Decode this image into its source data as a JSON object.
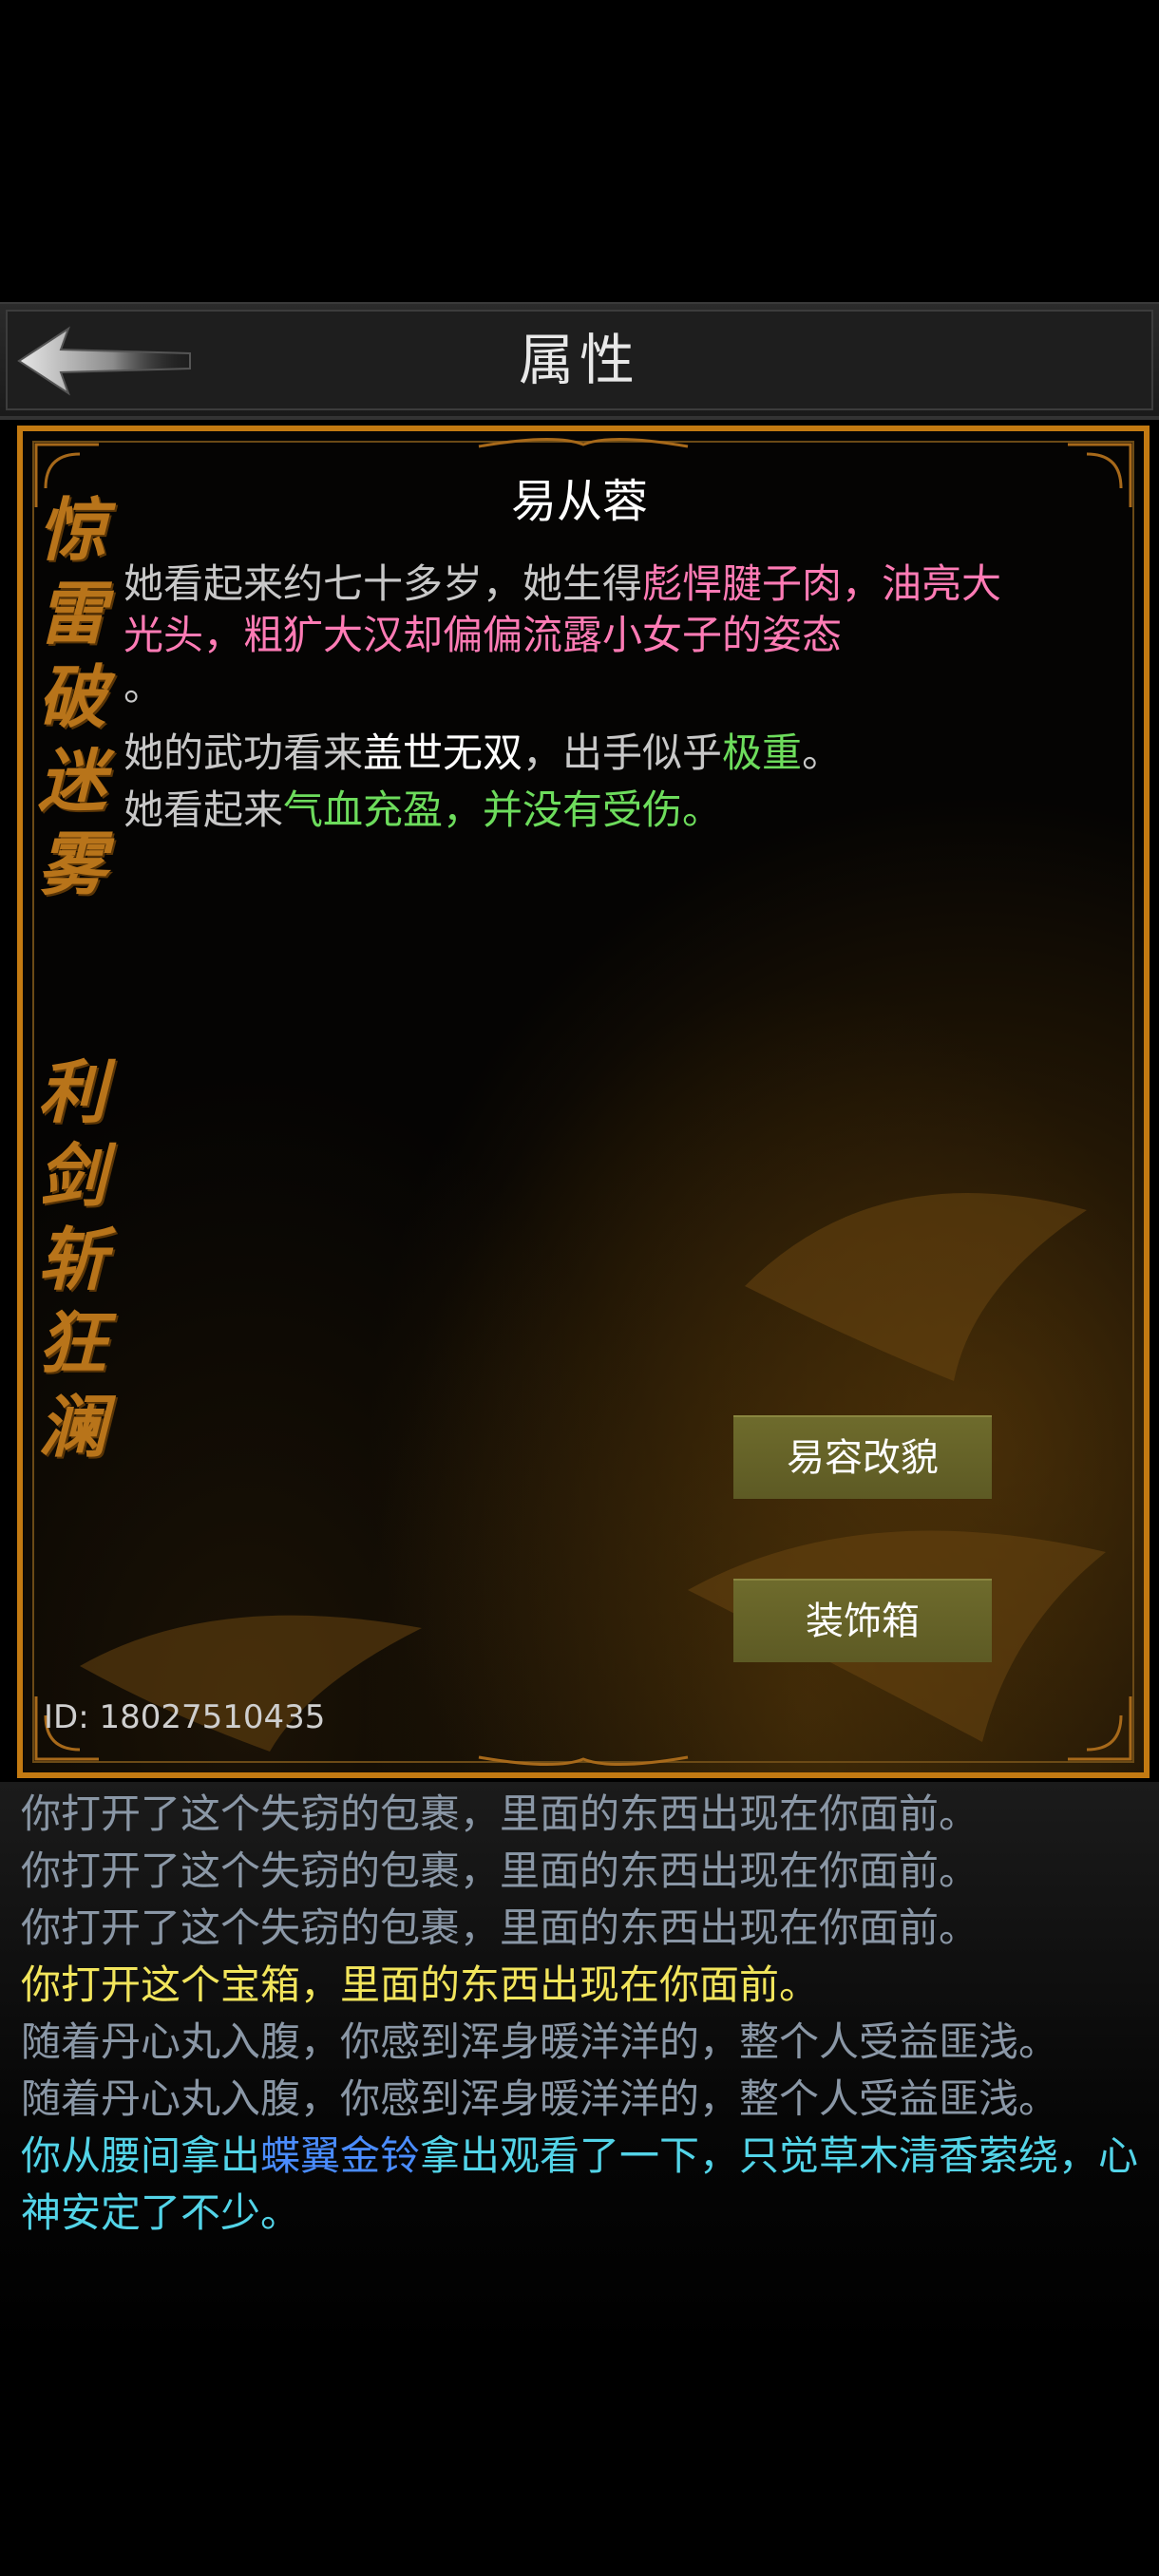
{
  "header": {
    "title": "属性",
    "back_icon": "back-arrow-icon"
  },
  "side_text": {
    "line1": "惊雷破迷雾",
    "line2": "利剑斩狂澜"
  },
  "character": {
    "name": "易从蓉",
    "desc1_plain": "她看起来约七十多岁，她生得",
    "desc1_pink": "彪悍腱子肉，油亮大光头，粗犷大汉却偏偏流露小女子的姿态",
    "desc1_end": "。",
    "desc2_plain": "她的武功看来",
    "desc2_white": "盖世无双",
    "desc2_mid": "，出手似乎",
    "desc2_green": "极重",
    "desc2_end": "。",
    "desc3_plain": "她看起来",
    "desc3_green": "气血充盈，并没有受伤。"
  },
  "buttons": {
    "disguise": "易容改貌",
    "wardrobe": "装饰箱"
  },
  "player": {
    "id_label": "ID: 18027510435"
  },
  "log": {
    "line1": "你打开了这个失窃的包裹，里面的东西出现在你面前。",
    "line2": "你打开了这个失窃的包裹，里面的东西出现在你面前。",
    "line3": "你打开了这个失窃的包裹，里面的东西出现在你面前。",
    "line4": "你打开这个宝箱，里面的东西出现在你面前。",
    "line5": "随着丹心丸入腹，你感到浑身暖洋洋的，整个人受益匪浅。",
    "line6": "随着丹心丸入腹，你感到浑身暖洋洋的，整个人受益匪浅。",
    "line7_a": "你从腰间拿出",
    "line7_item": "蝶翼金铃",
    "line7_b": "拿出观看了一下，只觉草木清香萦绕，心神安定了不少。"
  },
  "colors": {
    "panel_border": "#c37a12",
    "side_text": "#b8741a",
    "highlight_pink": "#ff7bb5",
    "highlight_green": "#6ddc5c",
    "log_gray": "#8a97a6",
    "log_yellow": "#f2e55c",
    "log_cyan": "#53d4e8",
    "log_blue": "#4a8cff",
    "button_bg": "#6e6b2c"
  }
}
